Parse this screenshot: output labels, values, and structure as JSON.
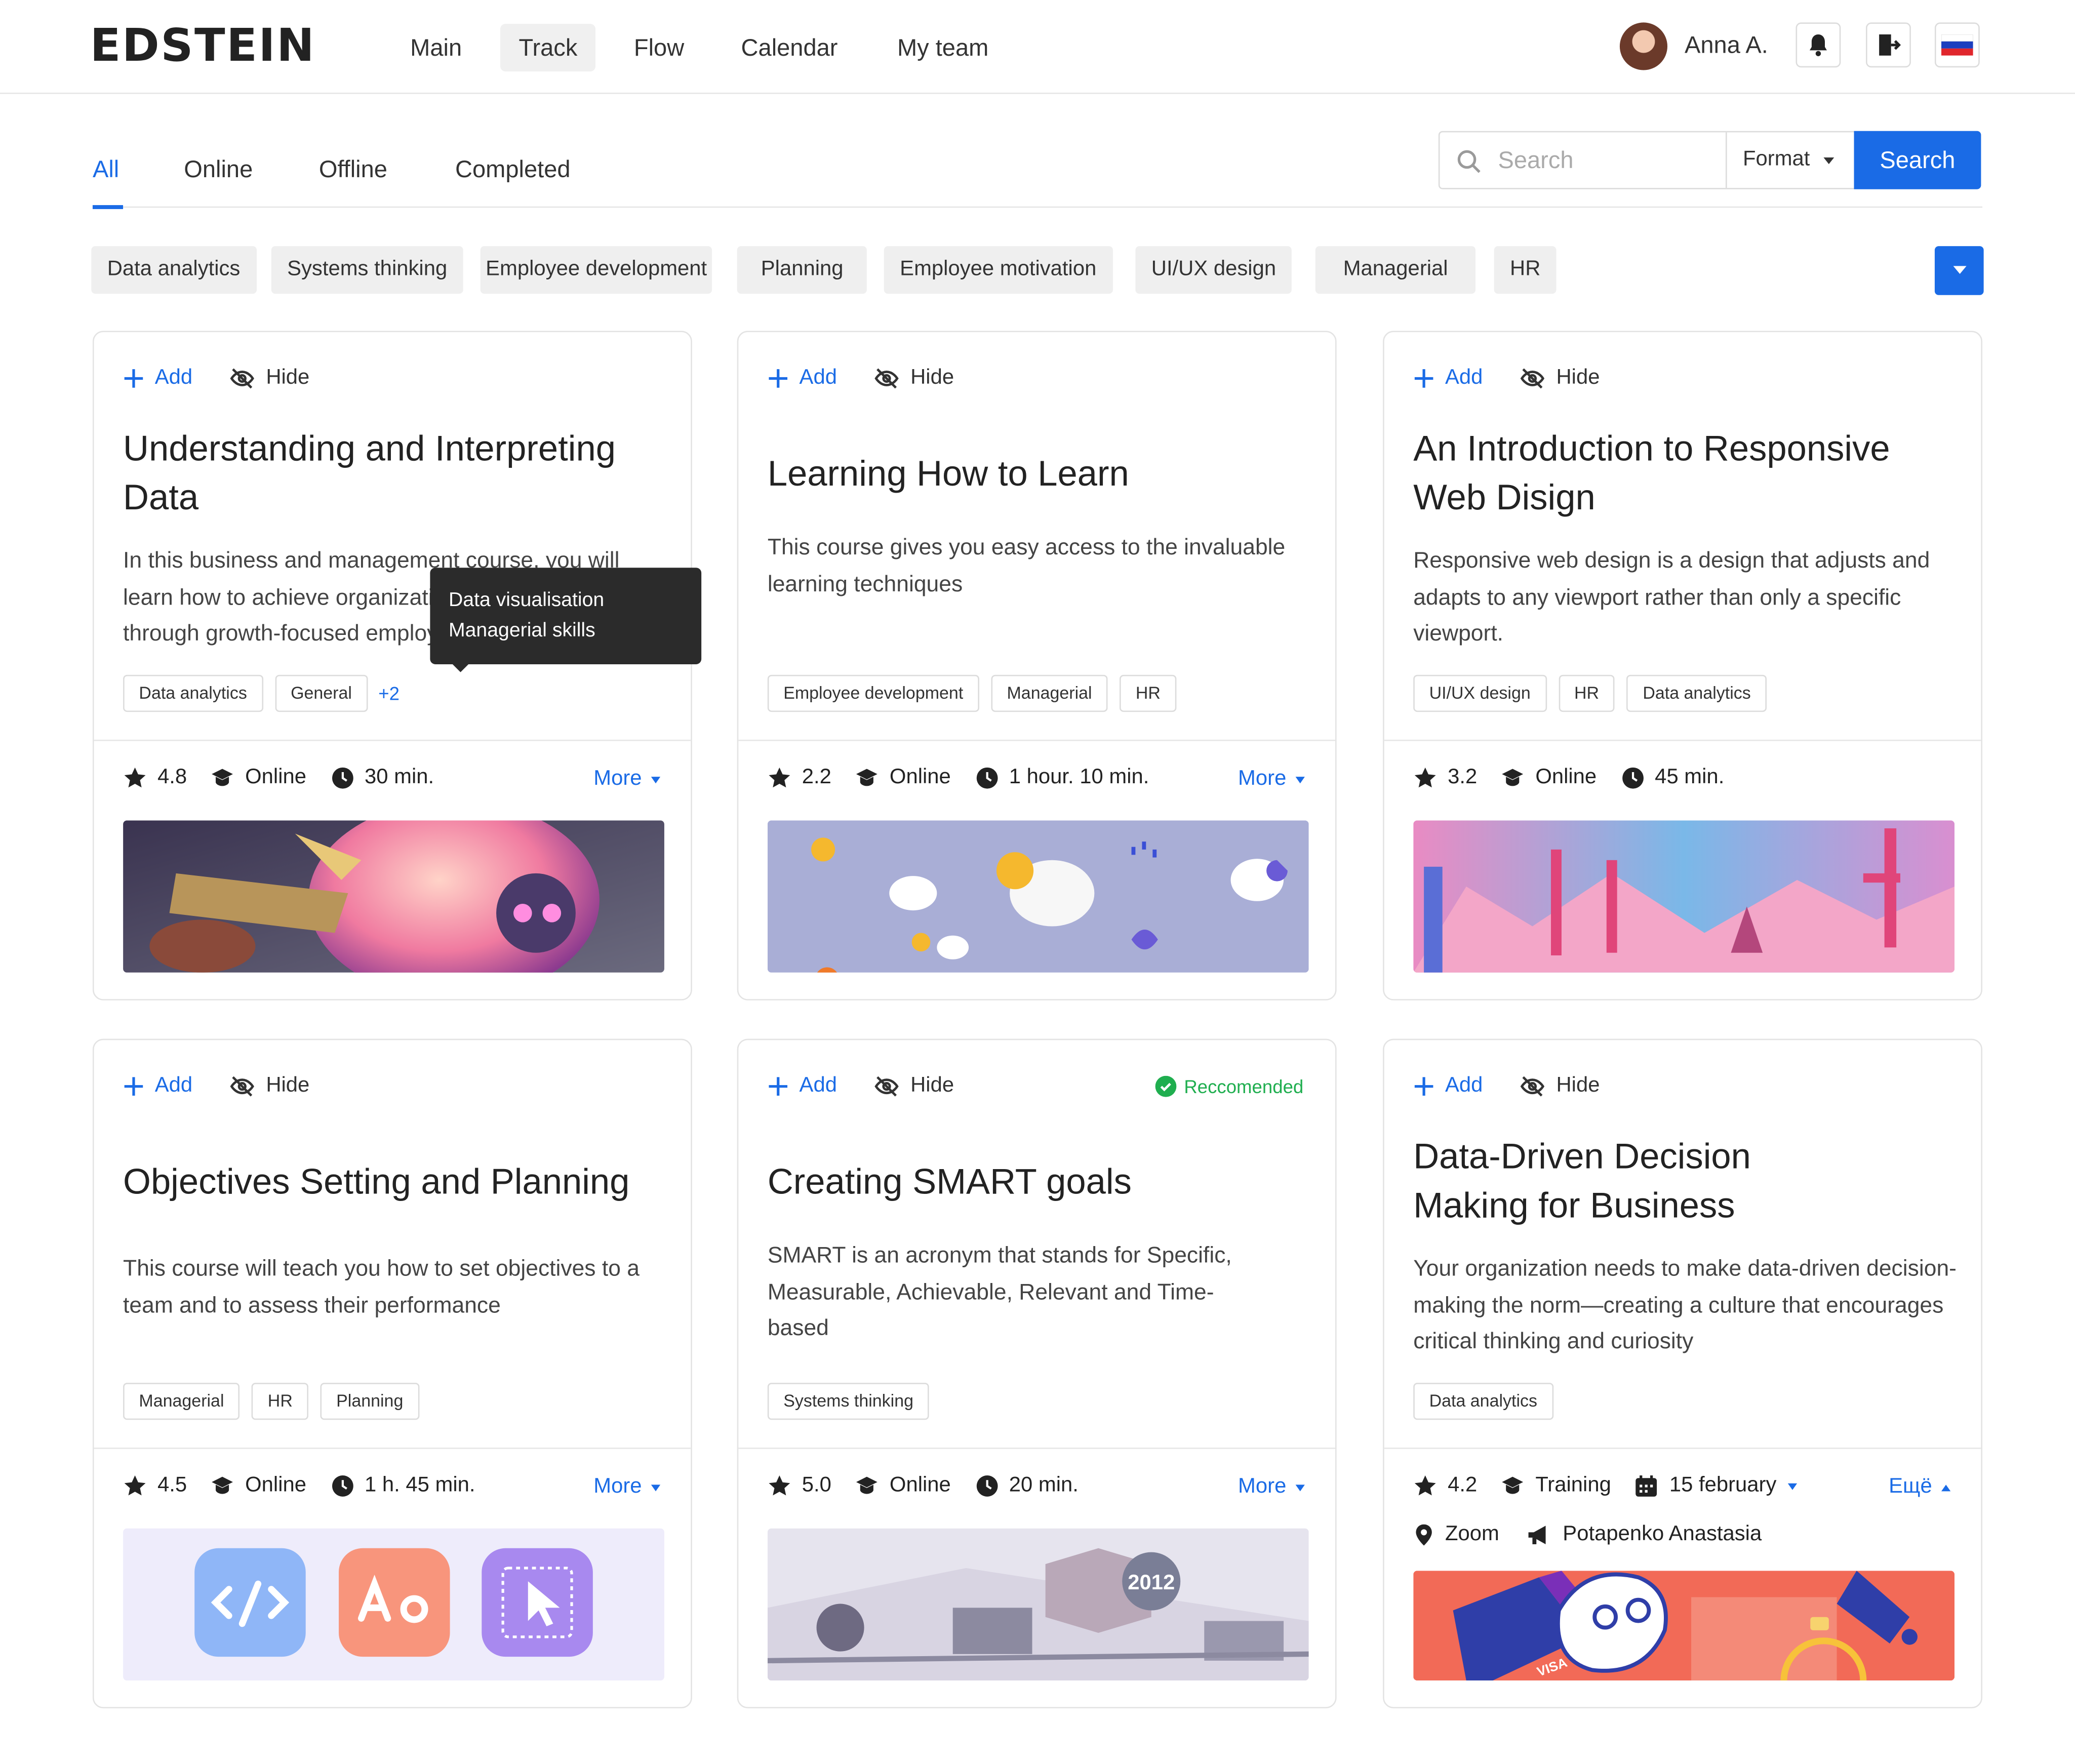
{
  "header": {
    "logo": "EDSTEIN",
    "nav": [
      {
        "label": "Main"
      },
      {
        "label": "Track",
        "active": true
      },
      {
        "label": "Flow"
      },
      {
        "label": "Calendar"
      },
      {
        "label": "My team"
      }
    ],
    "user_name": "Anna A."
  },
  "tabs": [
    {
      "label": "All",
      "active": true
    },
    {
      "label": "Online"
    },
    {
      "label": "Offline"
    },
    {
      "label": "Completed"
    }
  ],
  "search": {
    "placeholder": "Search",
    "format_label": "Format",
    "button_label": "Search"
  },
  "filters": [
    "Data analytics",
    "Systems thinking",
    "Employee development",
    "Planning",
    "Employee motivation",
    "UI/UX design",
    "Managerial",
    "HR"
  ],
  "card_actions": {
    "add": "Add",
    "hide": "Hide"
  },
  "recommended_label": "Reccomended",
  "tooltip": {
    "lines": [
      "Data visualisation",
      "Managerial skills"
    ]
  },
  "cards": [
    {
      "title": "Understanding and Interpreting Data",
      "description": "In this business and management course, you will learn how to achieve organizational excellence through growth-focused employee development.",
      "tags": [
        "Data analytics",
        "General"
      ],
      "tags_more": "+2",
      "rating": "4.8",
      "format": "Online",
      "duration": "30 min.",
      "more": "More",
      "image": "pink-piggy-robot"
    },
    {
      "title": "Learning How to Learn",
      "description": "This course gives you easy access to the invaluable learning techniques",
      "tags": [
        "Employee development",
        "Managerial",
        "HR"
      ],
      "rating": "2.2",
      "format": "Online",
      "duration": "1 hour. 10 min.",
      "more": "More",
      "image": "weather-clouds"
    },
    {
      "title": "An Introduction to Responsive Web Disign",
      "description": "Responsive web design is a design that adjusts and adapts to any viewport rather than only a specific viewport.",
      "tags": [
        "UI/UX design",
        "HR",
        "Data analytics"
      ],
      "rating": "3.2",
      "format": "Online",
      "duration": "45 min.",
      "image": "pink-crystal-landscape"
    },
    {
      "title": "Objectives Setting and Planning",
      "description": "This course will teach you how to set objectives to a team and to assess their performance",
      "tags": [
        "Managerial",
        "HR",
        "Planning"
      ],
      "rating": "4.5",
      "format": "Online",
      "duration": "1 h. 45 min.",
      "more": "More",
      "image": "app-icons"
    },
    {
      "title": "Creating SMART goals",
      "description": "SMART is an acronym that stands for Specific, Measurable, Achievable, Relevant and Time-based",
      "tags": [
        "Systems thinking"
      ],
      "rating": "5.0",
      "format": "Online",
      "duration": "20 min.",
      "more": "More",
      "recommended": true,
      "image": "machinery-2012",
      "image_text": "2012"
    },
    {
      "title": "Data-Driven Decision Making for Business",
      "description": "Your organization needs to make data-driven decision-making the norm—creating a culture that encourages critical thinking and curiosity",
      "tags": [
        "Data analytics"
      ],
      "rating": "4.2",
      "format": "Training",
      "date": "15 february",
      "location": "Zoom",
      "speaker": "Potapenko Anastasia",
      "more": "Ещё",
      "image": "red-visa-cards",
      "image_text": "VISA"
    }
  ],
  "colors": {
    "accent": "#1a6be6",
    "recommended": "#1fae4f",
    "chip_bg": "#efefef"
  }
}
